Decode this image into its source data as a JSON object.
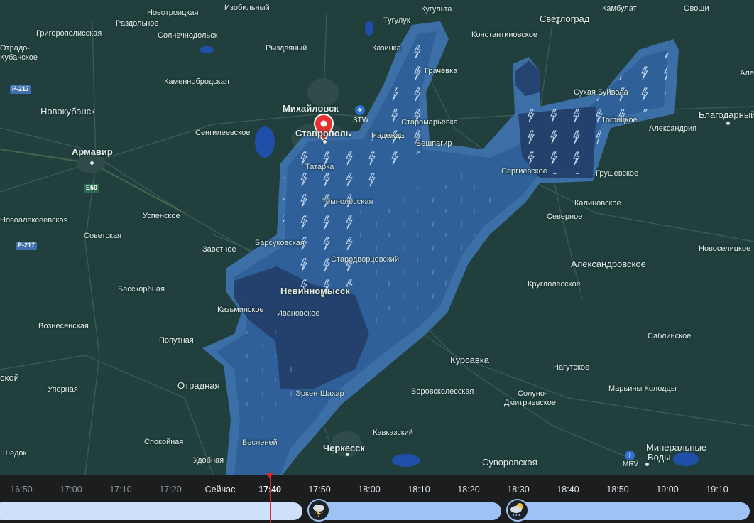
{
  "map": {
    "places": {
      "izobilny": "Изобильный",
      "novotroitskaya": "Новотроицкая",
      "razdolnoe": "Раздольное",
      "solnechnodolsk": "Солнечнодольск",
      "grigoropolisskaya": "Григорополисская",
      "otrado": "Отрадо-",
      "kubanskoe": "Кубанское",
      "ryzdvyany": "Рыздвяный",
      "tuguluk": "Тугулук",
      "kugulta": "Кугульта",
      "svetlograd": "Светлоград",
      "kambulat": "Камбулат",
      "ovoshchi": "Овощи",
      "konstantinovskoe": "Константиновское",
      "kazinka": "Казинка",
      "grachevka": "Грачёвка",
      "kamennobrodskaya": "Каменнобродская",
      "novokubansk": "Новокубанск",
      "mikhaylovsk": "Михайловск",
      "stavropol": "Ставрополь",
      "staromaryevka": "Старомарьевка",
      "nadezhda": "Надежда",
      "sukhaya_buyvola": "Сухая Буйвола",
      "blagodarny": "Благодарный",
      "tofitskoe": "Тофицкое",
      "aleksandriya": "Александрия",
      "sengileevskoe": "Сенгилеевское",
      "armavir": "Армавир",
      "beshpagir": "Бешпагир",
      "tatarka": "Татарка",
      "sergievskoe": "Сергиевское",
      "grushevskoe": "Грушевское",
      "temnolesskaya": "Темнолесская",
      "kalinovskoe": "Калиновское",
      "uspenskoe": "Успенское",
      "severnoe": "Северное",
      "novoalekseevskaya": "Новоалексеевская",
      "sovetskaya": "Советская",
      "barsukovskaya": "Барсуковская",
      "zavetnoe": "Заветное",
      "starodvortsovsky": "Стародворцовский",
      "novoselitskoe": "Новоселицкое",
      "aleksandrovskoe": "Александровское",
      "nevinnomyssk": "Невинномысск",
      "bessorbnaya": "Бесскорбная",
      "kruglolesskoe": "Круглолесское",
      "kazminskoe": "Казьминское",
      "ivanovskoe": "Ивановское",
      "voznesenskaya": "Вознесенская",
      "poputnaya": "Попутная",
      "sablinskoe": "Саблинское",
      "kursavka": "Курсавка",
      "nagutskoe": "Нагутское",
      "skoy": "ской",
      "upornaya": "Упорная",
      "otradnaya": "Отрадная",
      "erken_shakhar": "Эркен-Шахар",
      "vorovskolesskaya": "Воровсколесская",
      "soluno": "Солуно-",
      "dmitrievskoe": "Дмитриевское",
      "mariny_kolodtsy": "Марьины Колодцы",
      "kavkazsky": "Кавказский",
      "spokoynaya": "Спокойная",
      "besleney": "Бесленей",
      "cherkessk": "Черкесск",
      "mineralnye": "Минеральные",
      "vody": "Воды",
      "shedok": "Шедок",
      "udobnaya": "Удобная",
      "suvorovskaya": "Суворовская",
      "ale": "Але"
    },
    "roads": {
      "r217a": "Р-217",
      "r217b": "Р-217",
      "e50": "E50"
    },
    "airports": {
      "stw": "STW",
      "mrv": "MRV"
    },
    "colors": {
      "background": "#21403d",
      "precip_light": "#3f78b8",
      "precip_mid": "#2f5f99",
      "precip_dark": "#243f6b",
      "pin": "#e8322f",
      "playhead": "#e1262b"
    }
  },
  "timeline": {
    "ticks": [
      "16:50",
      "17:00",
      "17:10",
      "17:20",
      "Сейчас",
      "17:40",
      "17:50",
      "18:00",
      "18:10",
      "18:20",
      "18:30",
      "18:40",
      "18:50",
      "19:00",
      "19:10"
    ],
    "current": "17:40",
    "now_label": "Сейчас",
    "icons": [
      "thunderstorm-icon",
      "partly-cloudy-rain-icon"
    ]
  }
}
